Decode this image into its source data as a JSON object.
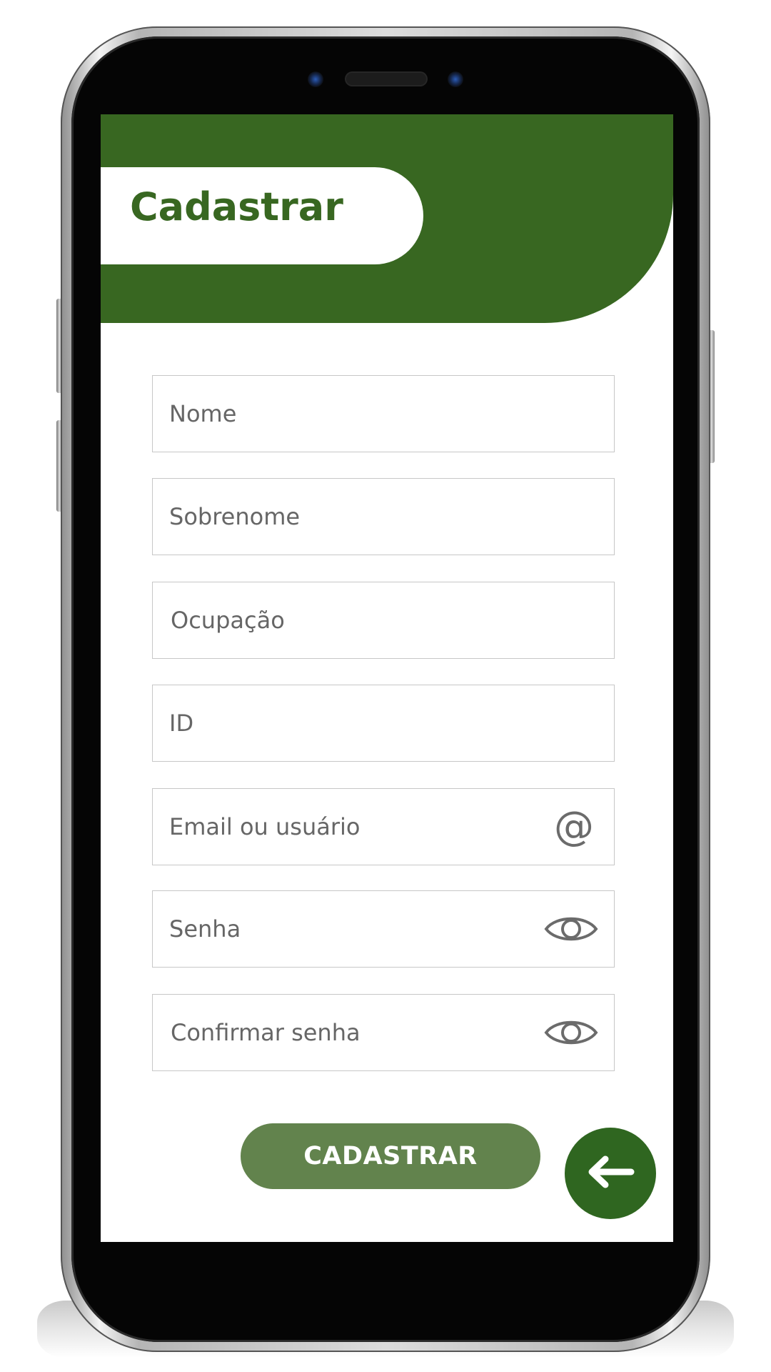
{
  "header": {
    "title": "Cadastrar"
  },
  "form": {
    "fields": [
      {
        "label": "Nome"
      },
      {
        "label": "Sobrenome"
      },
      {
        "label": "Ocupação"
      },
      {
        "label": "ID"
      },
      {
        "label": "Email ou usuário",
        "icon": "at-icon"
      },
      {
        "label": "Senha",
        "icon": "eye-icon"
      },
      {
        "label": "Confirmar senha",
        "icon": "eye-icon"
      }
    ]
  },
  "actions": {
    "submit_label": "CADASTRAR",
    "back_icon": "arrow-left-icon"
  },
  "colors": {
    "primary_green": "#386721",
    "button_green": "#62834d",
    "back_button_green": "#2f6620",
    "placeholder_text": "#666666",
    "field_border": "#c7c7c7"
  }
}
